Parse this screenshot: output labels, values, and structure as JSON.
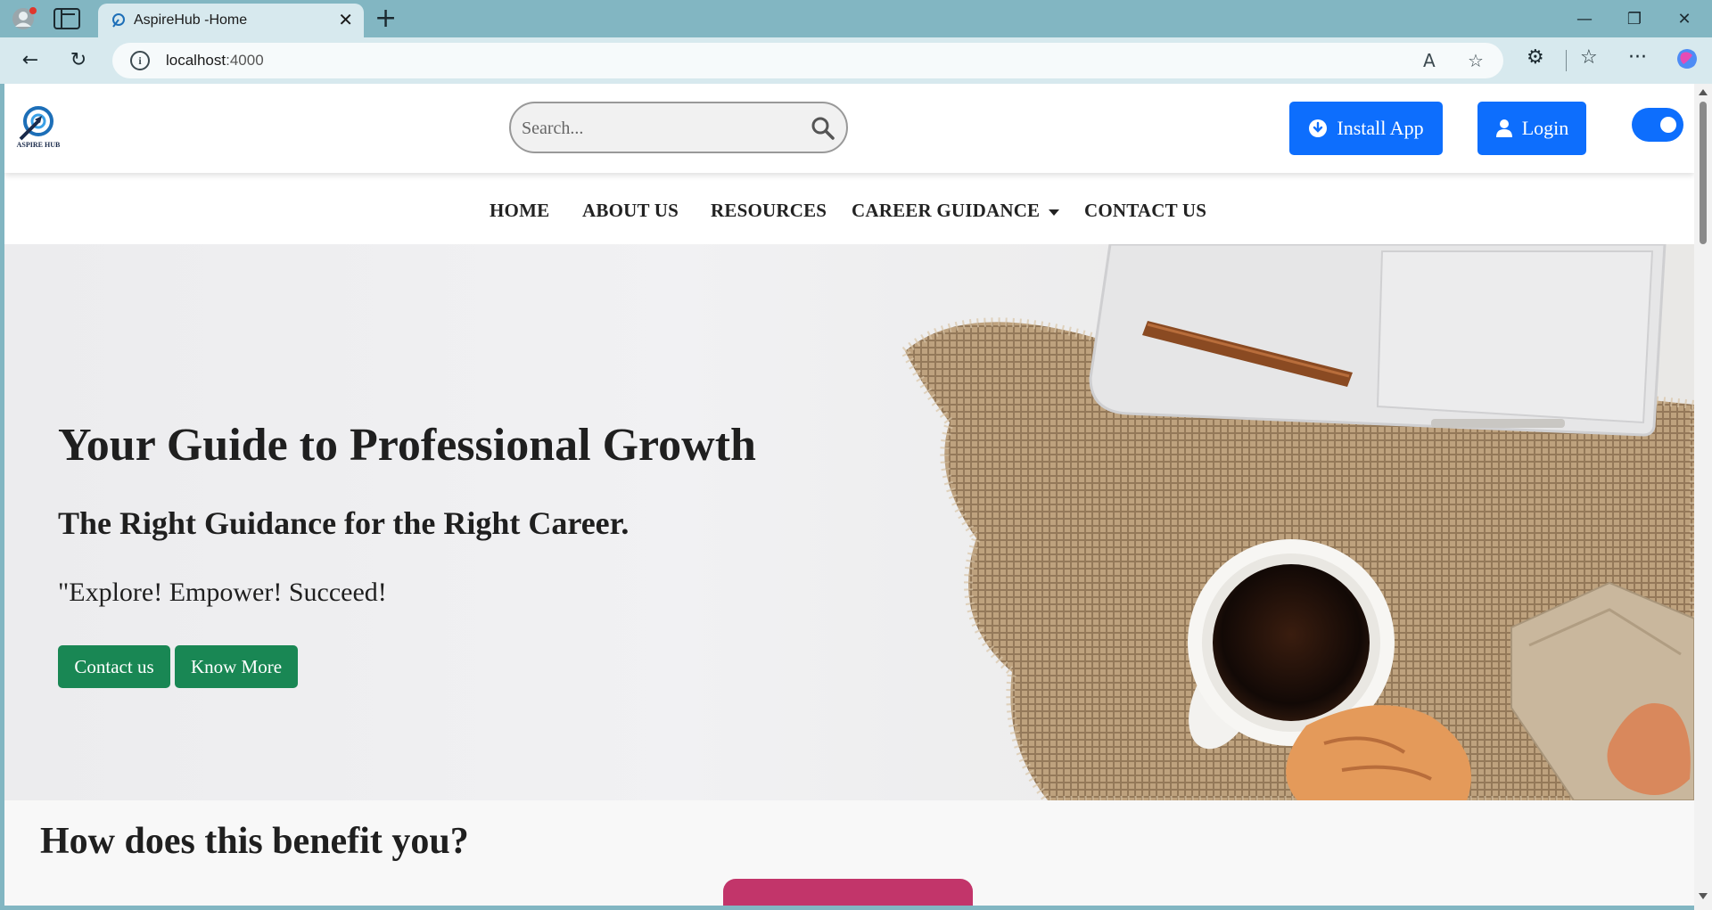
{
  "browser": {
    "tab_title": "AspireHub -Home",
    "url_host": "localhost",
    "url_port": ":4000",
    "tab_close": "✕",
    "new_tab": "+"
  },
  "header": {
    "logo_text": "ASPIRE HUB",
    "search_placeholder": "Search...",
    "install_label": "Install App",
    "login_label": "Login"
  },
  "nav": {
    "items": [
      {
        "label": "HOME"
      },
      {
        "label": "ABOUT US"
      },
      {
        "label": "RESOURCES"
      },
      {
        "label": "CAREER GUIDANCE"
      },
      {
        "label": "CONTACT US"
      }
    ]
  },
  "hero": {
    "title": "Your Guide to Professional Growth",
    "subtitle": "The Right Guidance for the Right Career.",
    "quote": "\"Explore! Empower! Succeed!",
    "contact_label": "Contact us",
    "know_more_label": "Know More"
  },
  "benefit": {
    "title": "How does this benefit you?"
  },
  "colors": {
    "primary_blue": "#0d6efd",
    "success_green": "#198754",
    "accent_pink": "#c2356a",
    "chrome_teal": "#82b6c2"
  }
}
